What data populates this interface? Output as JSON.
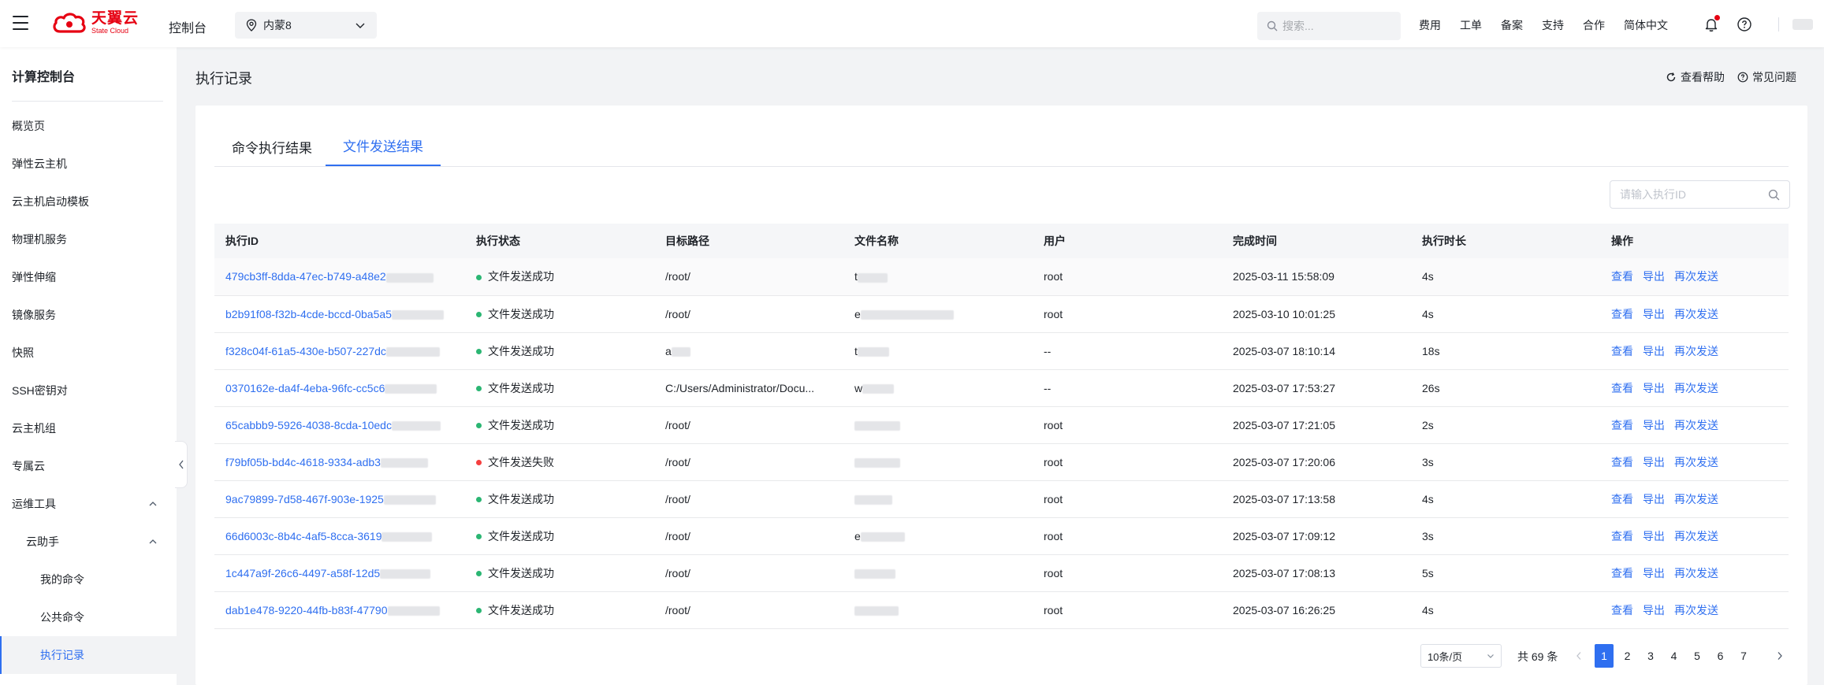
{
  "header": {
    "logo_cn": "天翼云",
    "logo_en": "State Cloud",
    "console_title": "控制台",
    "region": "内蒙8",
    "search_placeholder": "搜索...",
    "links": [
      "费用",
      "工单",
      "备案",
      "支持",
      "合作",
      "简体中文"
    ]
  },
  "sidebar": {
    "title": "计算控制台",
    "items": [
      {
        "label": "概览页"
      },
      {
        "label": "弹性云主机"
      },
      {
        "label": "云主机启动模板"
      },
      {
        "label": "物理机服务"
      },
      {
        "label": "弹性伸缩"
      },
      {
        "label": "镜像服务"
      },
      {
        "label": "快照"
      },
      {
        "label": "SSH密钥对"
      },
      {
        "label": "云主机组"
      },
      {
        "label": "专属云"
      },
      {
        "label": "运维工具"
      },
      {
        "label": "云助手"
      },
      {
        "label": "我的命令"
      },
      {
        "label": "公共命令"
      },
      {
        "label": "执行记录"
      }
    ]
  },
  "page": {
    "title": "执行记录",
    "help": "查看帮助",
    "faq": "常见问题"
  },
  "tabs": [
    "命令执行结果",
    "文件发送结果"
  ],
  "id_search_placeholder": "请输入执行ID",
  "table": {
    "columns": [
      "执行ID",
      "执行状态",
      "目标路径",
      "文件名称",
      "用户",
      "完成时间",
      "执行时长",
      "操作"
    ],
    "actions": [
      "查看",
      "导出",
      "再次发送"
    ],
    "rows": [
      {
        "id": "479cb3ff-8dda-47ec-b749-a48e2",
        "status": "文件发送成功",
        "path": "/root/",
        "file": "t",
        "user": "root",
        "time": "2025-03-11 15:58:09",
        "duration": "4s"
      },
      {
        "id": "b2b91f08-f32b-4cde-bccd-0ba5a5",
        "status": "文件发送成功",
        "path": "/root/",
        "file": "e",
        "user": "root",
        "time": "2025-03-10 10:01:25",
        "duration": "4s"
      },
      {
        "id": "f328c04f-61a5-430e-b507-227dc",
        "status": "文件发送成功",
        "path": "a",
        "file": "t",
        "user": "--",
        "time": "2025-03-07 18:10:14",
        "duration": "18s"
      },
      {
        "id": "0370162e-da4f-4eba-96fc-cc5c6",
        "status": "文件发送成功",
        "path": "C:/Users/Administrator/Docu...",
        "file": "w",
        "user": "--",
        "time": "2025-03-07 17:53:27",
        "duration": "26s"
      },
      {
        "id": "65cabbb9-5926-4038-8cda-10edc",
        "status": "文件发送成功",
        "path": "/root/",
        "file": "",
        "user": "root",
        "time": "2025-03-07 17:21:05",
        "duration": "2s"
      },
      {
        "id": "f79bf05b-bd4c-4618-9334-adb3",
        "status": "文件发送失败",
        "path": "/root/",
        "file": "",
        "user": "root",
        "time": "2025-03-07 17:20:06",
        "duration": "3s"
      },
      {
        "id": "9ac79899-7d58-467f-903e-1925",
        "status": "文件发送成功",
        "path": "/root/",
        "file": "",
        "user": "root",
        "time": "2025-03-07 17:13:58",
        "duration": "4s"
      },
      {
        "id": "66d6003c-8b4c-4af5-8cca-3619",
        "status": "文件发送成功",
        "path": "/root/",
        "file": "e",
        "user": "root",
        "time": "2025-03-07 17:09:12",
        "duration": "3s"
      },
      {
        "id": "1c447a9f-26c6-4497-a58f-12d5",
        "status": "文件发送成功",
        "path": "/root/",
        "file": "",
        "user": "root",
        "time": "2025-03-07 17:08:13",
        "duration": "5s"
      },
      {
        "id": "dab1e478-9220-44fb-b83f-47790",
        "status": "文件发送成功",
        "path": "/root/",
        "file": "",
        "user": "root",
        "time": "2025-03-07 16:26:25",
        "duration": "4s"
      }
    ]
  },
  "pagination": {
    "page_size": "10条/页",
    "total": "共 69 条",
    "pages": [
      "1",
      "2",
      "3",
      "4",
      "5",
      "6",
      "7"
    ],
    "current": "1"
  },
  "colors": {
    "accent": "#2f6ff0",
    "brand_red": "#e60012",
    "success": "#2bb673",
    "fail": "#f53f3f"
  }
}
